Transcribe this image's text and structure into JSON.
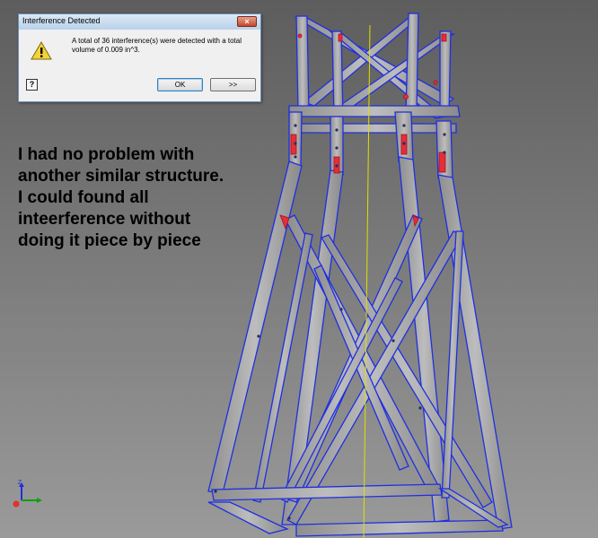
{
  "dialog": {
    "title": "Interference Detected",
    "message": "A total of 36 interference(s) were detected with a total volume of 0.009 in^3.",
    "ok_label": "OK",
    "more_label": ">>",
    "close_symbol": "×",
    "help_symbol": "?",
    "icons": [
      "warning-icon",
      "help-icon",
      "close-icon"
    ]
  },
  "annotation": {
    "lines": [
      "I had no problem with",
      "another similar structure.",
      "I could found all",
      "inteerference without",
      "doing it piece by piece"
    ]
  },
  "triad": {
    "z_label": "Z"
  },
  "colors": {
    "edge_highlight": "#1f2fe0",
    "interference": "#e0303a",
    "axis_line": "#e0e000",
    "background_top": "#5d5d5d",
    "background_bottom": "#9a9a9a"
  }
}
